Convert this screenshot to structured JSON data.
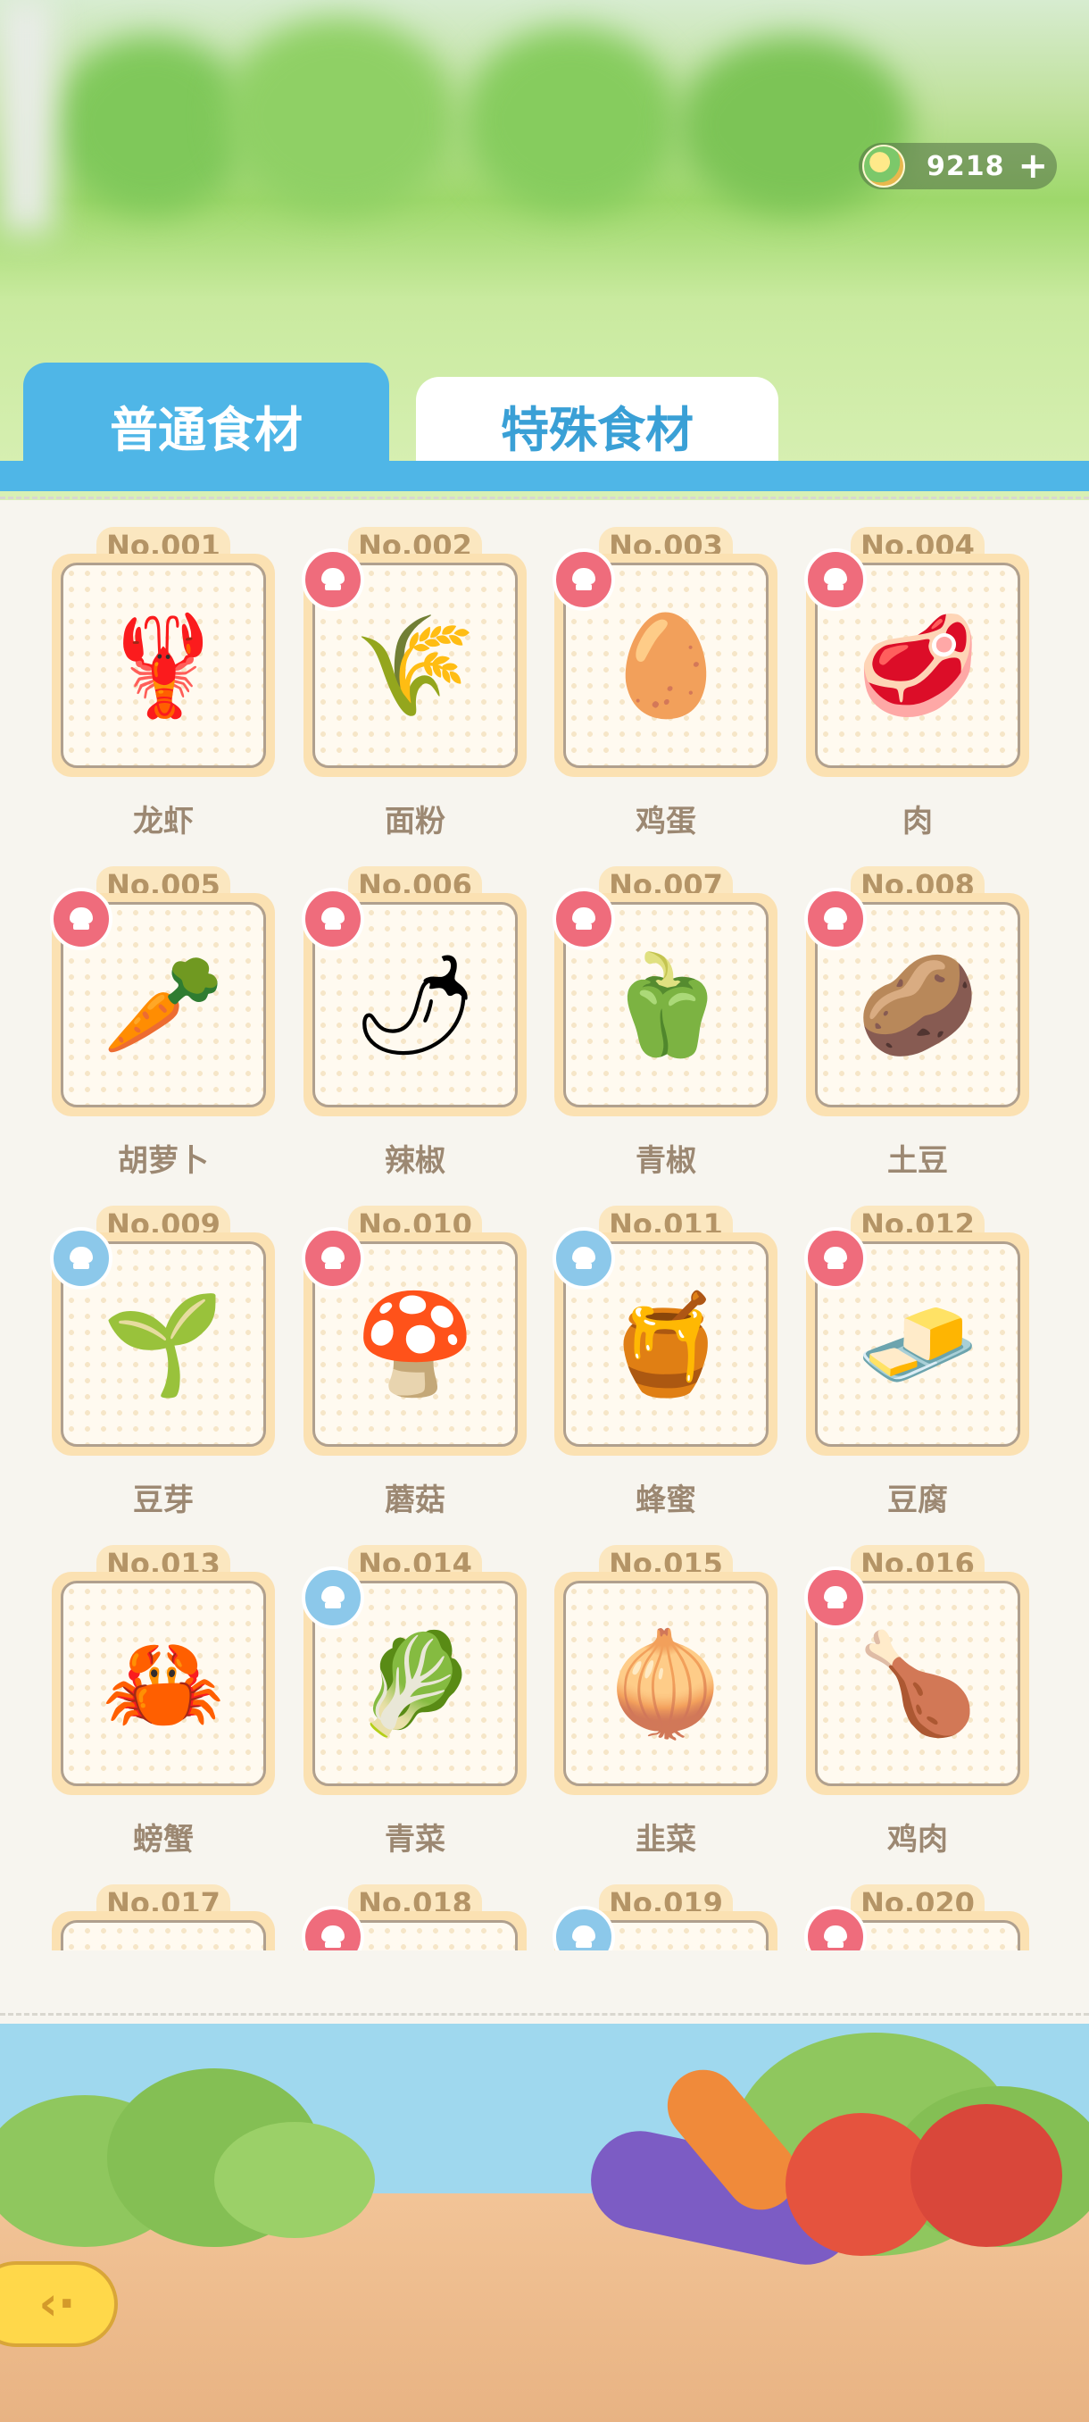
{
  "currency": {
    "value": "9218",
    "icon": "coin-icon",
    "add_icon": "plus-icon"
  },
  "tabs": [
    {
      "label": "普通食材",
      "active": true
    },
    {
      "label": "特殊食材",
      "active": false
    }
  ],
  "items": [
    {
      "no": "No.001",
      "name": "龙虾",
      "badge": "none",
      "icon": "lobster",
      "glyph": "🦞"
    },
    {
      "no": "No.002",
      "name": "面粉",
      "badge": "red",
      "icon": "flour-sack",
      "glyph": "🌾"
    },
    {
      "no": "No.003",
      "name": "鸡蛋",
      "badge": "red",
      "icon": "eggs",
      "glyph": "🥚"
    },
    {
      "no": "No.004",
      "name": "肉",
      "badge": "red",
      "icon": "meat-tray",
      "glyph": "🥩"
    },
    {
      "no": "No.005",
      "name": "胡萝卜",
      "badge": "red",
      "icon": "carrot",
      "glyph": "🥕"
    },
    {
      "no": "No.006",
      "name": "辣椒",
      "badge": "red",
      "icon": "chili",
      "glyph": "🌶"
    },
    {
      "no": "No.007",
      "name": "青椒",
      "badge": "red",
      "icon": "green-pepper",
      "glyph": "🫑"
    },
    {
      "no": "No.008",
      "name": "土豆",
      "badge": "red",
      "icon": "potato",
      "glyph": "🥔"
    },
    {
      "no": "No.009",
      "name": "豆芽",
      "badge": "blue",
      "icon": "bean-sprouts",
      "glyph": "🌱"
    },
    {
      "no": "No.010",
      "name": "蘑菇",
      "badge": "red",
      "icon": "mushroom",
      "glyph": "🍄"
    },
    {
      "no": "No.011",
      "name": "蜂蜜",
      "badge": "blue",
      "icon": "honey-jar",
      "glyph": "🍯"
    },
    {
      "no": "No.012",
      "name": "豆腐",
      "badge": "red",
      "icon": "tofu",
      "glyph": "🧈"
    },
    {
      "no": "No.013",
      "name": "螃蟹",
      "badge": "none",
      "icon": "crab",
      "glyph": "🦀"
    },
    {
      "no": "No.014",
      "name": "青菜",
      "badge": "blue",
      "icon": "bok-choy",
      "glyph": "🥬"
    },
    {
      "no": "No.015",
      "name": "韭菜",
      "badge": "none",
      "icon": "leek",
      "glyph": "🧅"
    },
    {
      "no": "No.016",
      "name": "鸡肉",
      "badge": "red",
      "icon": "drumstick",
      "glyph": "🍗"
    },
    {
      "no": "No.017",
      "name": "",
      "badge": "none",
      "icon": "",
      "glyph": ""
    },
    {
      "no": "No.018",
      "name": "",
      "badge": "red",
      "icon": "",
      "glyph": ""
    },
    {
      "no": "No.019",
      "name": "",
      "badge": "blue",
      "icon": "",
      "glyph": ""
    },
    {
      "no": "No.020",
      "name": "",
      "badge": "red",
      "icon": "",
      "glyph": ""
    }
  ],
  "badge_colors": {
    "red": "#ef6c7c",
    "blue": "#8cc8ea"
  },
  "accent_color": "#4fb6e7",
  "back_icon": "back-arrow-icon"
}
